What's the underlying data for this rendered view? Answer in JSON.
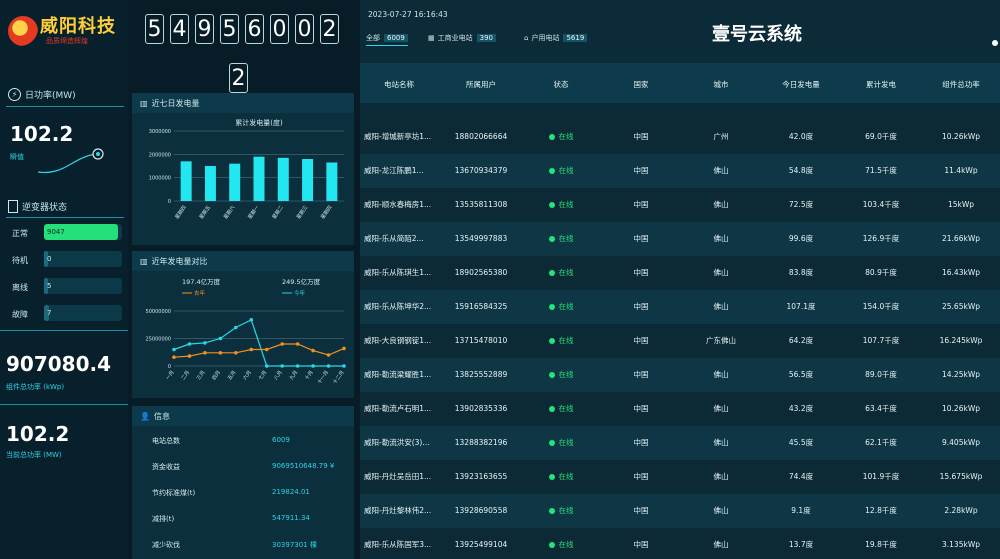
{
  "brand": {
    "title": "威阳科技",
    "subtitle": "品质缔造辉煌"
  },
  "counter": {
    "digits": [
      "5",
      "4",
      "9",
      "5",
      "6",
      "0",
      "0",
      "2",
      "2"
    ]
  },
  "left": {
    "power_label": "日功率(MW)",
    "power_value": "102.2",
    "power_unit": "瞬值",
    "inverter_label": "逆变器状态",
    "inverter": [
      {
        "label": "正常",
        "value": "9047",
        "pct": 0.95
      },
      {
        "label": "待机",
        "value": "0",
        "pct": 0.0
      },
      {
        "label": "离线",
        "value": "5",
        "pct": 0.05
      },
      {
        "label": "故障",
        "value": "7",
        "pct": 0.07
      }
    ],
    "capacity_value": "907080.4",
    "capacity_label": "组件总功率 (kWp)",
    "current_value": "102.2",
    "current_label": "当前总功率 (MW)"
  },
  "chart1": {
    "title": "近七日发电量",
    "chart_data": {
      "type": "bar",
      "title": "累计发电量(度)",
      "categories": [
        "星期四",
        "星期五",
        "星期六",
        "星期一",
        "星期二",
        "星期三",
        "星期四"
      ],
      "values": [
        1700000,
        1500000,
        1600000,
        1900000,
        1850000,
        1800000,
        1650000
      ],
      "ylim": [
        0,
        3000000
      ],
      "yticks": [
        "3000000",
        "2000000",
        "1000000",
        "0"
      ]
    }
  },
  "chart2": {
    "title": "近年发电量对比",
    "legend": [
      {
        "value": "197.4亿万度",
        "name": "去年",
        "color": "#f09020"
      },
      {
        "value": "249.5亿万度",
        "name": "今年",
        "color": "#29d6e6"
      }
    ],
    "chart_data": {
      "type": "line",
      "categories": [
        "一月",
        "二月",
        "三月",
        "四月",
        "五月",
        "六月",
        "七月",
        "八月",
        "九月",
        "十月",
        "十一月",
        "十二月"
      ],
      "yticks": [
        "50000000",
        "25000000",
        "0"
      ],
      "ylim": [
        0,
        50000000
      ],
      "series": [
        {
          "name": "今年",
          "color": "#29d6e6",
          "values": [
            15000000,
            20000000,
            21000000,
            25000000,
            35000000,
            42000000,
            0,
            0,
            0,
            0,
            0,
            0
          ]
        },
        {
          "name": "去年",
          "color": "#f09020",
          "values": [
            8000000,
            9000000,
            12000000,
            12000000,
            12000000,
            15000000,
            15000000,
            20000000,
            20000000,
            14000000,
            10000000,
            16000000
          ]
        }
      ]
    }
  },
  "info": {
    "title": "信息",
    "rows": [
      {
        "label": "电站总数",
        "value": "6009"
      },
      {
        "label": "资金收益",
        "value": "9069510648.79 ¥"
      },
      {
        "label": "节约标准煤(t)",
        "value": "219824.01"
      },
      {
        "label": "减排(t)",
        "value": "547911.34"
      },
      {
        "label": "减少砍伐",
        "value": "30397301 棵"
      }
    ]
  },
  "top": {
    "datetime": "2023-07-27 16:16:43",
    "title": "壹号云系统",
    "tabs": [
      {
        "label": "全部",
        "count": "6009"
      },
      {
        "label": "工商业电站",
        "count": "390"
      },
      {
        "label": "户用电站",
        "count": "5619"
      }
    ]
  },
  "table": {
    "headers": [
      "电站名称",
      "所属用户",
      "状态",
      "国家",
      "城市",
      "今日发电量",
      "累计发电",
      "组件总功率"
    ],
    "rows": [
      [
        "威阳-增城新亭坊1...",
        "18802066664",
        "在线",
        "中国",
        "广州",
        "42.0度",
        "69.0千度",
        "10.26kWp"
      ],
      [
        "威阳-龙江陈鹏1...",
        "13670934379",
        "在线",
        "中国",
        "佛山",
        "54.8度",
        "71.5千度",
        "11.4kWp"
      ],
      [
        "威阳-顺水春梅房1...",
        "13535811308",
        "在线",
        "中国",
        "佛山",
        "72.5度",
        "103.4千度",
        "15kWp"
      ],
      [
        "威阳-乐从简陌2...",
        "13549997883",
        "在线",
        "中国",
        "佛山",
        "99.6度",
        "126.9千度",
        "21.66kWp"
      ],
      [
        "威阳-乐从陈琪生1...",
        "18902565380",
        "在线",
        "中国",
        "佛山",
        "83.8度",
        "80.9千度",
        "16.43kWp"
      ],
      [
        "威阳-乐从陈坤华2...",
        "15916584325",
        "在线",
        "中国",
        "佛山",
        "107.1度",
        "154.0千度",
        "25.65kWp"
      ],
      [
        "威阳-大良钢钢锭1...",
        "13715478010",
        "在线",
        "中国",
        "广东佛山",
        "64.2度",
        "107.7千度",
        "16.245kWp"
      ],
      [
        "威阳-勒流梁耀胜1...",
        "13825552889",
        "在线",
        "中国",
        "佛山",
        "56.5度",
        "89.0千度",
        "14.25kWp"
      ],
      [
        "威阳-勒流卢石明1...",
        "13902835336",
        "在线",
        "中国",
        "佛山",
        "43.2度",
        "63.4千度",
        "10.26kWp"
      ],
      [
        "威阳-勒流洪安(3)...",
        "13288382196",
        "在线",
        "中国",
        "佛山",
        "45.5度",
        "62.1千度",
        "9.405kWp"
      ],
      [
        "威阳-丹灶吴岳田1...",
        "13923163655",
        "在线",
        "中国",
        "佛山",
        "74.4度",
        "101.9千度",
        "15.675kWp"
      ],
      [
        "威阳-丹灶黎林伟2...",
        "13928690558",
        "在线",
        "中国",
        "佛山",
        "9.1度",
        "12.8千度",
        "2.28kWp"
      ],
      [
        "威阳-乐从陈国军3...",
        "13925499104",
        "在线",
        "中国",
        "佛山",
        "13.7度",
        "19.8千度",
        "3.135kWp"
      ]
    ]
  }
}
